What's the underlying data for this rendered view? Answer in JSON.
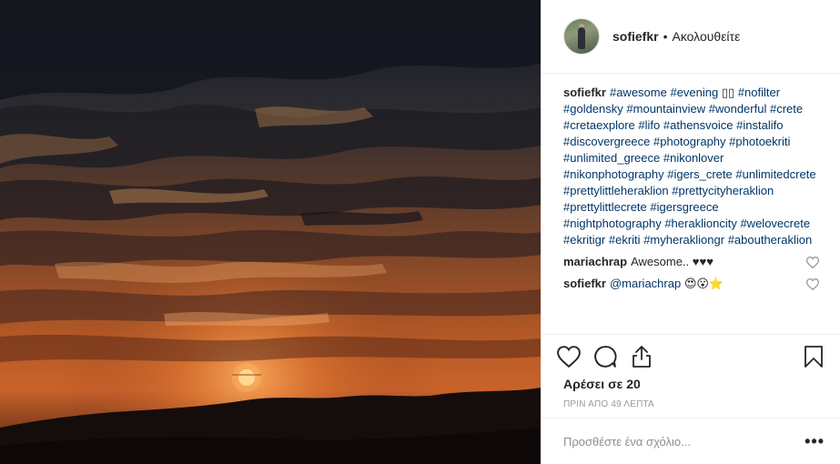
{
  "post": {
    "username": "sofiefkr",
    "separator": "•",
    "follow_label": "Ακολουθείτε"
  },
  "caption": {
    "username": "sofiefkr",
    "segments": [
      {
        "type": "tag",
        "text": "#awesome"
      },
      {
        "type": "text",
        "text": " "
      },
      {
        "type": "tag",
        "text": "#evening"
      },
      {
        "type": "text",
        "text": " ▯▯  "
      },
      {
        "type": "tag",
        "text": "#nofilter"
      },
      {
        "type": "text",
        "text": " "
      },
      {
        "type": "tag",
        "text": "#goldensky"
      },
      {
        "type": "text",
        "text": " "
      },
      {
        "type": "tag",
        "text": "#mountainview"
      },
      {
        "type": "text",
        "text": " "
      },
      {
        "type": "tag",
        "text": "#wonderful"
      },
      {
        "type": "text",
        "text": " "
      },
      {
        "type": "tag",
        "text": "#crete"
      },
      {
        "type": "text",
        "text": " "
      },
      {
        "type": "tag",
        "text": "#cretaexplore"
      },
      {
        "type": "text",
        "text": " "
      },
      {
        "type": "tag",
        "text": "#lifo"
      },
      {
        "type": "text",
        "text": " "
      },
      {
        "type": "tag",
        "text": "#athensvoice"
      },
      {
        "type": "text",
        "text": " "
      },
      {
        "type": "tag",
        "text": "#instalifo"
      },
      {
        "type": "text",
        "text": " "
      },
      {
        "type": "tag",
        "text": "#discovergreece"
      },
      {
        "type": "text",
        "text": " "
      },
      {
        "type": "tag",
        "text": "#photography"
      },
      {
        "type": "text",
        "text": " "
      },
      {
        "type": "tag",
        "text": "#photoekriti"
      },
      {
        "type": "text",
        "text": " "
      },
      {
        "type": "tag",
        "text": "#unlimited_greece"
      },
      {
        "type": "text",
        "text": " "
      },
      {
        "type": "tag",
        "text": "#nikonlover"
      },
      {
        "type": "text",
        "text": " "
      },
      {
        "type": "tag",
        "text": "#nikonphotography"
      },
      {
        "type": "text",
        "text": " "
      },
      {
        "type": "tag",
        "text": "#igers_crete"
      },
      {
        "type": "text",
        "text": " "
      },
      {
        "type": "tag",
        "text": "#unlimitedcrete"
      },
      {
        "type": "text",
        "text": " "
      },
      {
        "type": "tag",
        "text": "#prettylittleheraklion"
      },
      {
        "type": "text",
        "text": " "
      },
      {
        "type": "tag",
        "text": "#prettycityheraklion"
      },
      {
        "type": "text",
        "text": " "
      },
      {
        "type": "tag",
        "text": "#prettylittlecrete"
      },
      {
        "type": "text",
        "text": " "
      },
      {
        "type": "tag",
        "text": "#igersgreece"
      },
      {
        "type": "text",
        "text": " "
      },
      {
        "type": "tag",
        "text": "#nightphotography"
      },
      {
        "type": "text",
        "text": " "
      },
      {
        "type": "tag",
        "text": "#heraklioncity"
      },
      {
        "type": "text",
        "text": " "
      },
      {
        "type": "tag",
        "text": "#welovecrete"
      },
      {
        "type": "text",
        "text": " "
      },
      {
        "type": "tag",
        "text": "#ekritigr"
      },
      {
        "type": "text",
        "text": " "
      },
      {
        "type": "tag",
        "text": "#ekriti"
      },
      {
        "type": "text",
        "text": " "
      },
      {
        "type": "tag",
        "text": "#myherakliongr"
      },
      {
        "type": "text",
        "text": " "
      },
      {
        "type": "tag",
        "text": "#aboutheraklion"
      }
    ]
  },
  "comments": [
    {
      "username": "mariachrap",
      "text": "Awesome.. ♥♥♥",
      "mention": ""
    },
    {
      "username": "sofiefkr",
      "mention": "@mariachrap",
      "text": " 😍😮⭐"
    }
  ],
  "actions": {
    "likes_label": "Αρέσει σε 20",
    "time_label": "ΠΡΙΝ ΑΠΟ 49 ΛΕΠΤΑ",
    "comment_placeholder": "Προσθέστε ένα σχόλιο...",
    "more_label": "•••"
  },
  "icons": {
    "like": "heart-icon",
    "comment": "comment-icon",
    "share": "share-icon",
    "save": "bookmark-icon",
    "comment_like": "heart-icon"
  },
  "colors": {
    "hashtag": "#003569",
    "text": "#262626",
    "muted": "#999999",
    "border": "#efefef"
  }
}
